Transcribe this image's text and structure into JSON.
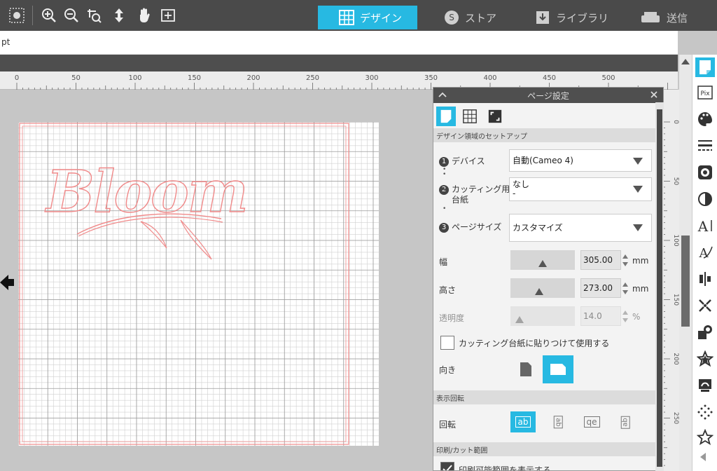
{
  "nav": {
    "tabs": [
      {
        "label": "デザイン",
        "icon": "grid-icon",
        "active": true
      },
      {
        "label": "ストア",
        "icon": "store-icon",
        "active": false
      },
      {
        "label": "ライブラリ",
        "icon": "library-icon",
        "active": false
      },
      {
        "label": "送信",
        "icon": "send-icon",
        "active": false
      }
    ]
  },
  "toolbar": {
    "tools": [
      "select-points-icon",
      "zoom-in-icon",
      "zoom-out-icon",
      "zoom-select-icon",
      "move-icon",
      "pan-hand-icon",
      "fit-to-page-icon"
    ]
  },
  "optbar": {
    "unit": "pt"
  },
  "ruler": {
    "labels": [
      "0",
      "50",
      "100",
      "150",
      "200",
      "250",
      "300",
      "350",
      "400",
      "450",
      "500"
    ]
  },
  "vruler": {
    "labels": [
      "0",
      "50",
      "100",
      "150",
      "200",
      "250"
    ]
  },
  "design": {
    "text": "Bloom"
  },
  "panel": {
    "title": "ページ設定",
    "sections": {
      "setup": "デザイン領域のセットアップ",
      "rotation": "表示回転",
      "print": "印刷/カット範囲"
    },
    "device": {
      "num": "1",
      "label": "デバイス",
      "value": "自動(Cameo 4)"
    },
    "mat": {
      "num": "2",
      "label_line1": "カッティング用",
      "label_line2": "台紙",
      "value_line1": "なし",
      "value_line2": "-"
    },
    "page_size": {
      "num": "3",
      "label": "ページサイズ",
      "value": "カスタマイズ"
    },
    "width": {
      "label": "幅",
      "value": "305.00",
      "unit": "mm",
      "slider_fraction": 0.5
    },
    "height": {
      "label": "高さ",
      "value": "273.00",
      "unit": "mm",
      "slider_fraction": 0.45
    },
    "transparency": {
      "label": "透明度",
      "value": "14.0",
      "unit": "%",
      "slider_fraction": 0.14
    },
    "use_mat_checkbox": {
      "label": "カッティング台紙に貼りつけて使用する",
      "checked": false
    },
    "orientation": {
      "label": "向き",
      "selected": "landscape"
    },
    "rotate": {
      "label": "回転",
      "buttons": [
        "ab",
        "ab",
        "qe",
        "ab"
      ],
      "selected": 0
    },
    "show_print": {
      "label": "印刷可能範囲を表示する",
      "checked": true
    }
  },
  "colors": {
    "accent": "#27b9e2",
    "cut_line": "#f08a8a"
  }
}
